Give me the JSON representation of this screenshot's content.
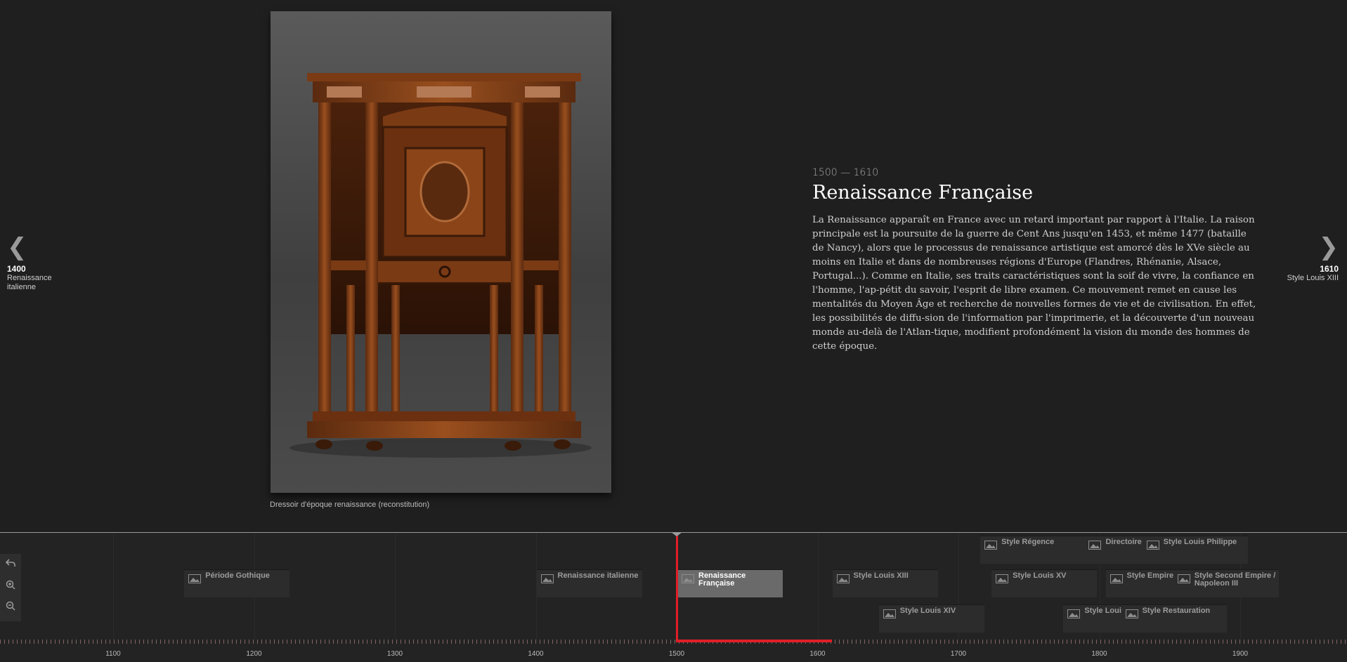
{
  "slide": {
    "prev": {
      "year": "1400",
      "title": "Renaissance italienne"
    },
    "next": {
      "year": "1610",
      "title": "Style Louis XIII"
    },
    "date_range": "1500 — 1610",
    "title": "Renaissance Française",
    "body": "La Renaissance apparaît en France avec un retard important par rapport à l'Italie. La raison principale est la poursuite de la guerre de Cent Ans jusqu'en 1453, et même 1477 (bataille de Nancy), alors que le processus de renaissance artistique est amorcé dès le XVe siècle au moins en Italie et dans de nombreuses régions d'Europe (Flandres, Rhénanie, Alsace, Portugal...). Comme en Italie, ses traits caractéristiques sont la soif de vivre, la confiance en l'homme, l'ap-pétit du savoir, l'esprit de libre examen. Ce mouvement remet en cause les mentalités du Moyen Âge et recherche de nouvelles formes de vie et de civilisation. En effet, les possibilités de diffu-sion de l'information par l'imprimerie, et la découverte d'un nouveau monde au-delà de l'Atlan-tique, modifient profondément la vision du monde des hommes de cette époque.",
    "caption": "Dressoir d'époque renaissance (reconstitution)",
    "prev_icon": "chevron-left-icon",
    "next_icon": "chevron-right-icon"
  },
  "timeline": {
    "controls": [
      {
        "name": "back-icon",
        "symbol": "↶"
      },
      {
        "name": "zoom-in-icon",
        "symbol": "+"
      },
      {
        "name": "zoom-out-icon",
        "symbol": "−"
      }
    ],
    "markers": [
      {
        "label": "Période Gothique",
        "year": 1150,
        "row": 1,
        "active": false
      },
      {
        "label": "Renaissance italienne",
        "year": 1400,
        "row": 1,
        "active": false
      },
      {
        "label": "Renaissance Française",
        "year": 1500,
        "row": 1,
        "active": true
      },
      {
        "label": "Style Louis XIII",
        "year": 1610,
        "row": 1,
        "active": false
      },
      {
        "label": "Style Louis XIV",
        "year": 1643,
        "row": 2,
        "active": false
      },
      {
        "label": "Style Régence",
        "year": 1715,
        "row": 0,
        "active": false
      },
      {
        "label": "Style Louis XV",
        "year": 1723,
        "row": 1,
        "active": false
      },
      {
        "label": "Directoire",
        "year": 1789,
        "row": 0,
        "active": false
      },
      {
        "label": "Style Louis XVI",
        "year": 1774,
        "row": 2,
        "active": false
      },
      {
        "label": "Style Empire",
        "year": 1804,
        "row": 1,
        "active": false
      },
      {
        "label": "Style Restauration",
        "year": 1815,
        "row": 2,
        "active": false
      },
      {
        "label": "Style Louis Philippe",
        "year": 1830,
        "row": 0,
        "active": false
      },
      {
        "label": "Style Second Empire / Napoleon III",
        "year": 1852,
        "row": 1,
        "active": false
      }
    ],
    "axis": [
      "1100",
      "1200",
      "1300",
      "1400",
      "1500",
      "1600",
      "1700",
      "1800",
      "1900"
    ],
    "current_year": 1500,
    "era_end": 1610,
    "accent_color": "#e01e26"
  }
}
